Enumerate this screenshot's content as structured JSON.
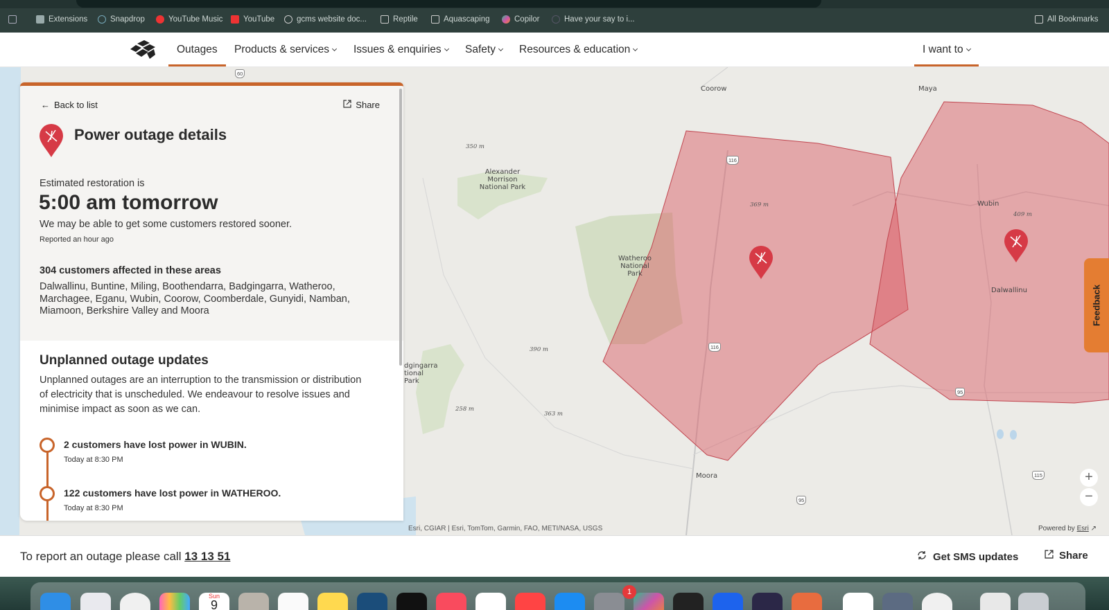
{
  "browser": {
    "bookmarks": [
      {
        "label": "Extensions",
        "icon": "puzzle-icon"
      },
      {
        "label": "Snapdrop",
        "icon": "snapdrop-icon"
      },
      {
        "label": "YouTube Music",
        "icon": "youtube-music-icon"
      },
      {
        "label": "YouTube",
        "icon": "youtube-icon"
      },
      {
        "label": "gcms website doc...",
        "icon": "globe-icon"
      },
      {
        "label": "Reptile",
        "icon": "folder-icon"
      },
      {
        "label": "Aquascaping",
        "icon": "folder-icon"
      },
      {
        "label": "Copilor",
        "icon": "copilot-icon"
      },
      {
        "label": "Have your say to i...",
        "icon": "globe-icon"
      }
    ],
    "all_bookmarks": "All Bookmarks"
  },
  "nav": {
    "logo": "site-logo-icon",
    "items": [
      "Outages",
      "Products & services",
      "Issues & enquiries",
      "Safety",
      "Resources & education"
    ],
    "i_want_to": "I want to"
  },
  "panel": {
    "back": "Back to list",
    "share": "Share",
    "title": "Power outage details",
    "est_label": "Estimated restoration is",
    "est_time": "5:00 am tomorrow",
    "est_note": "We may be able to get some customers restored sooner.",
    "reported": "Reported an hour ago",
    "affected_title": "304 customers affected in these areas",
    "affected_areas": "Dalwallinu, Buntine, Miling, Boothendarra, Badgingarra, Watheroo, Marchagee, Eganu, Wubin, Coorow, Coomberdale, Gunyidi, Namban, Miamoon, Berkshire Valley and Moora",
    "updates_title": "Unplanned outage updates",
    "updates_desc": "Unplanned outages are an interruption to the transmission or distribution of electricity that is unscheduled. We endeavour to resolve issues and minimise impact as soon as we can.",
    "updates": [
      {
        "title": "2 customers have lost power in WUBIN.",
        "time": "Today at 8:30 PM"
      },
      {
        "title": "122 customers have lost power in WATHEROO.",
        "time": "Today at 8:30 PM"
      }
    ]
  },
  "map": {
    "places": [
      "Coorow",
      "Maya",
      "Alexander Morrison National Park",
      "Watheroo National Park",
      "Wubin",
      "Dalwallinu",
      "Moora",
      "dgingarra tional Park"
    ],
    "elevations": [
      "350 m",
      "369 m",
      "409 m",
      "390 m",
      "258 m",
      "363 m"
    ],
    "roads": [
      "60",
      "116",
      "116",
      "95",
      "95",
      "115"
    ],
    "attribution": "Esri, CGIAR | Esri, TomTom, Garmin, FAO, METI/NASA, USGS",
    "powered_by": "Powered by",
    "esri": "Esri",
    "zoom_in": "+",
    "zoom_out": "−",
    "feedback": "Feedback",
    "outage_color": "#d9545e"
  },
  "footer": {
    "report_prefix": "To report an outage please call",
    "report_phone": "13 13 51",
    "sms": "Get SMS updates",
    "share": "Share"
  },
  "dock": {
    "calendar_month": "Sun",
    "calendar_day": "9",
    "badge": "1"
  }
}
